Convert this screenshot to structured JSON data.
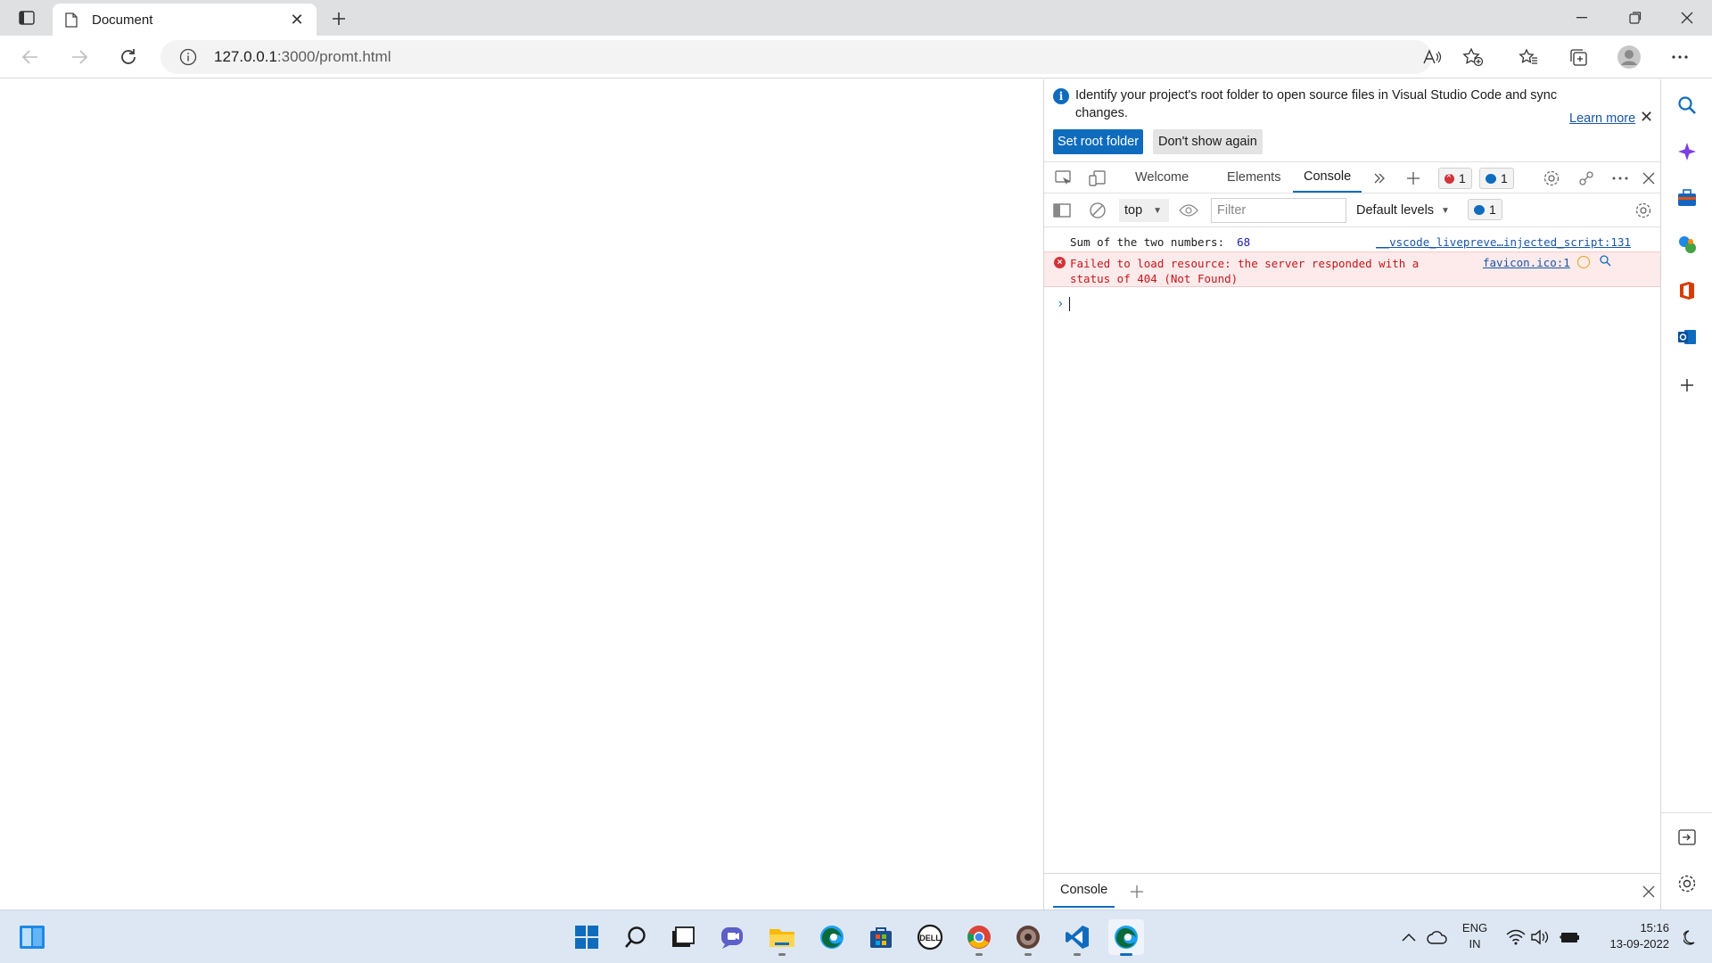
{
  "browser": {
    "tab_title": "Document",
    "url_host": "127.0.0.1",
    "url_rest": ":3000/promt.html"
  },
  "devtools": {
    "infobar": {
      "message": "Identify your project's root folder to open source files in Visual Studio Code and sync changes.",
      "learn_more": "Learn more",
      "set_root": "Set root folder",
      "dont_show": "Don't show again"
    },
    "tabs": {
      "welcome": "Welcome",
      "elements": "Elements",
      "console": "Console"
    },
    "error_count": "1",
    "message_count": "1",
    "context": "top",
    "filter_placeholder": "Filter",
    "levels": "Default levels",
    "levels_msg_count": "1",
    "logs": {
      "log1_text": "Sum of the two numbers:",
      "log1_value": "68",
      "log1_source": "__vscode_livepreview_injected_script:131",
      "log1_source_display": "__vscode_livepreve…injected_script:131",
      "err_text": "Failed to load resource: the server responded with a status of 404 (Not Found)",
      "err_source": "favicon.ico:1"
    },
    "drawer_tab": "Console"
  },
  "taskbar": {
    "lang_line1": "ENG",
    "lang_line2": "IN",
    "time": "15:16",
    "date": "13-09-2022"
  },
  "colors": {
    "accent": "#0f6cbd",
    "error_red": "#d13438",
    "error_bg": "#fdeaea",
    "taskbar_bg": "#dde7f3"
  }
}
